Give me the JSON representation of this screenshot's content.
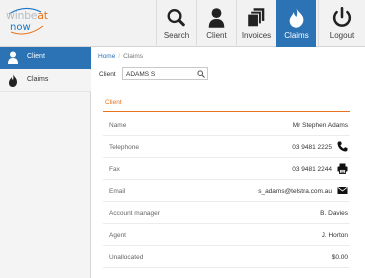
{
  "logo": {
    "line1_a": "winbe",
    "line1_b": "at",
    "line2": "now"
  },
  "nav": [
    {
      "label": "Search",
      "icon": "search-icon",
      "active": false
    },
    {
      "label": "Client",
      "icon": "user-icon",
      "active": false
    },
    {
      "label": "Invoices",
      "icon": "invoices-icon",
      "active": false
    },
    {
      "label": "Claims",
      "icon": "flame-icon",
      "active": true
    },
    {
      "label": "Logout",
      "icon": "power-icon",
      "active": false
    }
  ],
  "sidebar": {
    "items": [
      {
        "label": "Client",
        "icon": "user-icon",
        "active": true
      },
      {
        "label": "Claims",
        "icon": "flame-icon",
        "active": false
      }
    ]
  },
  "breadcrumb": {
    "home": "Home",
    "current": "Claims"
  },
  "client_search": {
    "label": "Client",
    "value": "ADAMS S",
    "icon": "search-icon"
  },
  "section": {
    "title": "Client"
  },
  "details": [
    {
      "label": "Name",
      "value": "Mr Stephen Adams"
    },
    {
      "label": "Telephone",
      "value": "03 9481 2225",
      "icon": "phone-icon"
    },
    {
      "label": "Fax",
      "value": "03 9481 2244",
      "icon": "printer-icon"
    },
    {
      "label": "Email",
      "value": "s_adams@telstra.com.au",
      "icon": "envelope-icon"
    },
    {
      "label": "Account manager",
      "value": "B. Davies"
    },
    {
      "label": "Agent",
      "value": "J. Horton"
    },
    {
      "label": "Unallocated",
      "value": "$0.00"
    }
  ],
  "colors": {
    "accent": "#2b73b4",
    "orange": "#e8731c"
  }
}
